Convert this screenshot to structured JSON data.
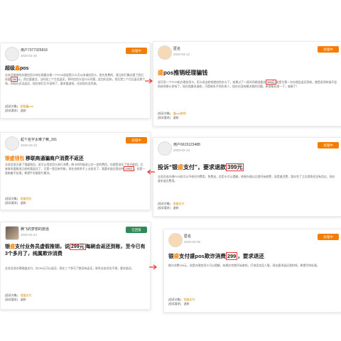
{
  "cards": [
    {
      "user": "用户7377325818",
      "date": "2020-02-26",
      "badge": "处理中",
      "title_pre": "超级",
      "title_hl": "鑫",
      "title_post": "pos",
      "body_pre": "业务员推销的办理信用卡时拉闸要办理一个POS机说是什么可以申请信用卡，首先免费的，我当时打算办理了然后说要",
      "price": "299",
      "body_post": "元，然后要激活，当时说三个月会返还，到时信用卡没什么问题，此包扣全款，然后是三个月后返还那个钱，到现在还没返还，现在他们又不说明了，要求要退钱，还说现在没完成。",
      "meta": [
        "[投诉对象]",
        "超级鑫pos",
        "[投诉要求]",
        "退款"
      ]
    },
    {
      "user": "匿名",
      "date": "2020-03-12",
      "badge": "处理中",
      "title_pre": "",
      "title_hl": "盛",
      "title_post": "pos推销经理骗钱",
      "body_pre": "说可用一个POS机办理信用卡，用卡说这收钱就给你办卡了，结果过了一段时间就说要交",
      "price": "399元",
      "body_post": "说是为第一次办理会返还到账，就是说到时候不会再给你那么多钱了，现在我要求退款，可是联系不到负责人，现在也没有解决我的问题，希望能处理一下，谢谢了！",
      "meta": [
        "[投诉对象]",
        "盛pos推销",
        "[投诉要求]",
        "退款"
      ]
    },
    {
      "user": "起个名字太难了嘛_391",
      "date": "2020-03-10",
      "badge": "处理中",
      "title_pre": "",
      "title_hl": "银盛钱包",
      "title_post": " 移联商通骗商户消费不返还",
      "body_pre": "业务员说注册了银盛钱包，说可以用信用卡进行消费，刷卡的时候说让交一定的费用，也就是说交了钱才能用，后来联系客服说已经给我返还了，可是一直没有到账，现在也联系不上业务员了，我要求退还我交的",
      "price": "199元",
      "body_post": "，但是一直拖着不处理，希望平台能帮忙解决。",
      "meta": [
        "[投诉对象]",
        "银盛钱包",
        "[投诉要求]",
        "退款"
      ]
    },
    {
      "user": "用户6615123488",
      "date": "2020-02-13",
      "badge": "处理中",
      "title_pre": "投诉“银",
      "title_hl": "盛",
      "title_post": "支付”，要求退款",
      "price": "399元",
      "body_pre": "业务员说办理POS机可以不收任何费用，免费送，信用卡可以提额，结果办理以后就开始收费，说是激活费，我办完了之后就再也没有用过，现在要求退还费用。",
      "body_post": "",
      "meta": [
        "[投诉对象]",
        "银盛支付",
        "[投诉要求]",
        "退款"
      ]
    },
    {
      "user": "腾飞的梦想的旅途",
      "date": "2020-02-24",
      "badge": "已回复",
      "title_pre": "银",
      "title_hl": "盛",
      "title_post": "支付业务员虚假推销，说",
      "price": "299元",
      "title_post2": "每刷会返还到账，至今已有3个多月了，纯属欺诈消费",
      "body_pre": "业务员说办理银盛支付，交299元可以返还，现在三个多月了都没有返还，联系业务员也不理，要求退还。",
      "body_post": "",
      "meta": [
        "[投诉对象]",
        "银盛支付",
        "[投诉要求]",
        "退款"
      ]
    },
    {
      "user": "匿名",
      "date": "2020-02-05",
      "badge": "处理中",
      "title_pre": "银",
      "title_hl": "盛",
      "title_post": "支付盛pos欺诈消费",
      "price": "299",
      "title_post2": "，要求退还",
      "body_pre": "欺诈消费299元，说是办理信用卡可以提额，结果办完就开始收钱，打电话也没人管，现在要求退还我的钱，希望尽快处理。",
      "body_post": "",
      "meta": [
        "[投诉对象]",
        "银盛支付",
        "[投诉要求]",
        "退款"
      ]
    }
  ]
}
